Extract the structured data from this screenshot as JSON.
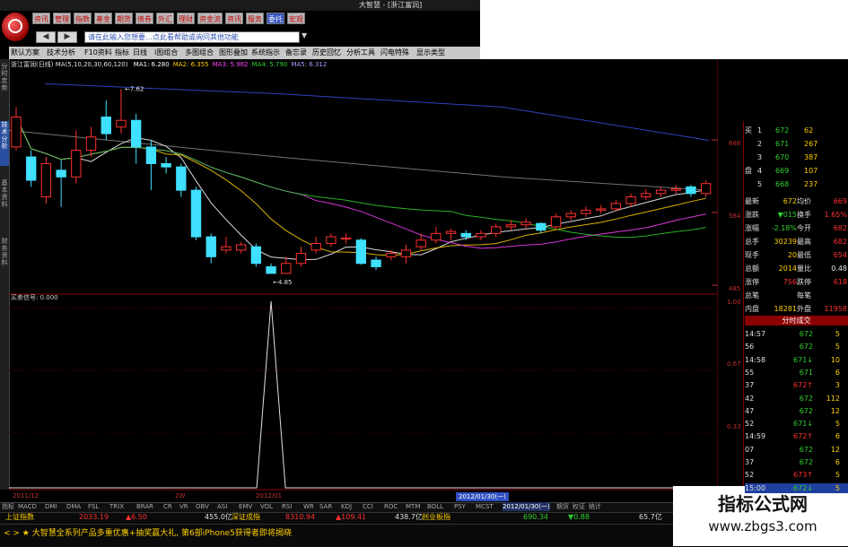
{
  "window": {
    "title": "大智慧 - [浙江富润]"
  },
  "top_buttons": [
    "资讯",
    "管理",
    "指数",
    "基金",
    "期货",
    "债券",
    "外汇",
    "理财",
    "资金流",
    "资讯",
    "服务",
    "委托",
    "宏观"
  ],
  "search": {
    "placeholder": "请在此输入您想要…点此看帮助或询问其他功能"
  },
  "toolbar": [
    "默认方案",
    "技术分析",
    "F10资料",
    "指标",
    "日线",
    "i图组合",
    "多图组合",
    "图形叠加",
    "系统指示",
    "备忘录",
    "历史回忆",
    "分析工具",
    "闪电特殊",
    "显示类型"
  ],
  "left_tabs": [
    "分时走势",
    "技术分析",
    "基本资料",
    "财务资料"
  ],
  "stock_name": "浙江富润(日线)",
  "ma_label": "MA(5,10,20,30,60,120)",
  "ma_values": [
    {
      "label": "MA1:",
      "value": "6.280",
      "color": "#ffffff"
    },
    {
      "label": "MA2:",
      "value": "6.355",
      "color": "#ffd000"
    },
    {
      "label": "MA3:",
      "value": "5.962",
      "color": "#ff40ff"
    },
    {
      "label": "MA4:",
      "value": "5.790",
      "color": "#30d030"
    },
    {
      "label": "MA5:",
      "value": "6.312",
      "color": "#a0a0ff"
    }
  ],
  "price_labels": {
    "high": "7.62",
    "low": "4.85"
  },
  "indicator_label": "买卖信号: 0.000",
  "y_axis": [
    "688",
    "584",
    "485",
    "1.00",
    "0.67",
    "0.33"
  ],
  "chart_data": {
    "type": "candlestick",
    "candles": [
      {
        "o": 6.75,
        "c": 7.2,
        "h": 7.35,
        "l": 6.7
      },
      {
        "o": 6.6,
        "c": 6.25,
        "h": 6.7,
        "l": 6.15
      },
      {
        "o": 6.0,
        "c": 6.5,
        "h": 6.6,
        "l": 5.9
      },
      {
        "o": 6.4,
        "c": 6.3,
        "h": 6.55,
        "l": 5.85
      },
      {
        "o": 6.3,
        "c": 6.7,
        "h": 7.0,
        "l": 6.2
      },
      {
        "o": 6.7,
        "c": 6.9,
        "h": 7.05,
        "l": 6.6
      },
      {
        "o": 7.2,
        "c": 6.95,
        "h": 7.45,
        "l": 6.85
      },
      {
        "o": 7.05,
        "c": 7.15,
        "h": 7.62,
        "l": 6.95
      },
      {
        "o": 7.15,
        "c": 6.75,
        "h": 7.25,
        "l": 6.5
      },
      {
        "o": 6.75,
        "c": 6.5,
        "h": 6.85,
        "l": 6.1
      },
      {
        "o": 6.5,
        "c": 6.45,
        "h": 6.6,
        "l": 6.35
      },
      {
        "o": 6.45,
        "c": 6.1,
        "h": 6.5,
        "l": 6.0
      },
      {
        "o": 6.1,
        "c": 5.4,
        "h": 6.15,
        "l": 5.35
      },
      {
        "o": 5.4,
        "c": 5.1,
        "h": 5.45,
        "l": 5.0
      },
      {
        "o": 5.2,
        "c": 5.25,
        "h": 5.4,
        "l": 5.15
      },
      {
        "o": 5.2,
        "c": 5.28,
        "h": 5.32,
        "l": 5.15
      },
      {
        "o": 5.25,
        "c": 5.0,
        "h": 5.3,
        "l": 4.95
      },
      {
        "o": 4.95,
        "c": 4.85,
        "h": 5.0,
        "l": 4.85
      },
      {
        "o": 4.85,
        "c": 5.0,
        "h": 5.1,
        "l": 4.85
      },
      {
        "o": 5.0,
        "c": 5.15,
        "h": 5.25,
        "l": 4.95
      },
      {
        "o": 5.2,
        "c": 5.3,
        "h": 5.4,
        "l": 5.15
      },
      {
        "o": 5.3,
        "c": 5.4,
        "h": 5.45,
        "l": 5.25
      },
      {
        "o": 5.38,
        "c": 5.38,
        "h": 5.45,
        "l": 5.3
      },
      {
        "o": 5.35,
        "c": 5.0,
        "h": 5.38,
        "l": 4.98
      },
      {
        "o": 5.05,
        "c": 4.95,
        "h": 5.1,
        "l": 4.9
      },
      {
        "o": 5.1,
        "c": 5.15,
        "h": 5.2,
        "l": 5.05
      },
      {
        "o": 5.1,
        "c": 5.2,
        "h": 5.28,
        "l": 5.0
      },
      {
        "o": 5.25,
        "c": 5.35,
        "h": 5.45,
        "l": 5.2
      },
      {
        "o": 5.35,
        "c": 5.45,
        "h": 5.55,
        "l": 5.3
      },
      {
        "o": 5.45,
        "c": 5.48,
        "h": 5.52,
        "l": 5.35
      },
      {
        "o": 5.45,
        "c": 5.4,
        "h": 5.5,
        "l": 5.35
      },
      {
        "o": 5.4,
        "c": 5.45,
        "h": 5.5,
        "l": 5.35
      },
      {
        "o": 5.45,
        "c": 5.55,
        "h": 5.6,
        "l": 5.4
      },
      {
        "o": 5.55,
        "c": 5.58,
        "h": 5.65,
        "l": 5.5
      },
      {
        "o": 5.58,
        "c": 5.62,
        "h": 5.68,
        "l": 5.52
      },
      {
        "o": 5.6,
        "c": 5.5,
        "h": 5.62,
        "l": 5.45
      },
      {
        "o": 5.55,
        "c": 5.7,
        "h": 5.75,
        "l": 5.5
      },
      {
        "o": 5.7,
        "c": 5.75,
        "h": 5.8,
        "l": 5.65
      },
      {
        "o": 5.75,
        "c": 5.8,
        "h": 5.85,
        "l": 5.7
      },
      {
        "o": 5.8,
        "c": 5.82,
        "h": 5.88,
        "l": 5.75
      },
      {
        "o": 5.82,
        "c": 5.9,
        "h": 5.95,
        "l": 5.78
      },
      {
        "o": 5.9,
        "c": 6.0,
        "h": 6.05,
        "l": 5.85
      },
      {
        "o": 6.0,
        "c": 6.05,
        "h": 6.12,
        "l": 5.95
      },
      {
        "o": 6.05,
        "c": 6.1,
        "h": 6.15,
        "l": 6.0
      },
      {
        "o": 6.1,
        "c": 6.12,
        "h": 6.18,
        "l": 6.05
      },
      {
        "o": 6.15,
        "c": 6.05,
        "h": 6.18,
        "l": 6.0
      },
      {
        "o": 6.05,
        "c": 6.2,
        "h": 6.25,
        "l": 6.0
      }
    ],
    "price_range": [
      4.7,
      7.8
    ],
    "signal": {
      "index": 17,
      "value": 1.0
    },
    "signal_range": [
      0,
      1
    ]
  },
  "quote": {
    "buy": [
      {
        "label": "买",
        "n": "1",
        "price": "672",
        "vol": "62"
      },
      {
        "label": "",
        "n": "2",
        "price": "671",
        "vol": "267"
      },
      {
        "label": "",
        "n": "3",
        "price": "670",
        "vol": "387"
      },
      {
        "label": "盘",
        "n": "4",
        "price": "669",
        "vol": "107"
      },
      {
        "label": "",
        "n": "5",
        "price": "668",
        "vol": "237"
      }
    ],
    "stats": [
      {
        "k1": "最新",
        "v1": "672",
        "k2": "均价",
        "v2": "669"
      },
      {
        "k1": "涨跌",
        "v1": "▼015",
        "k2": "换手",
        "v2": "1.65%"
      },
      {
        "k1": "涨幅",
        "v1": "-2.18%",
        "k2": "今开",
        "v2": "682"
      },
      {
        "k1": "总手",
        "v1": "30239",
        "k2": "最高",
        "v2": "682"
      },
      {
        "k1": "现手",
        "v1": "20",
        "k2": "最低",
        "v2": "654"
      },
      {
        "k1": "总额",
        "v1": "2014",
        "k2": "量比",
        "v2": "0.48"
      },
      {
        "k1": "涨停",
        "v1": "756",
        "k2": "跌停",
        "v2": "618"
      },
      {
        "k1": "总笔",
        "v1": "",
        "k2": "每笔",
        "v2": ""
      },
      {
        "k1": "内盘",
        "v1": "18281",
        "k2": "外盘",
        "v2": "11958"
      }
    ],
    "ticks_header": "分时成交",
    "ticks": [
      {
        "t": "14:57",
        "p": "672",
        "v": "5"
      },
      {
        "t": "56",
        "p": "672",
        "v": "5"
      },
      {
        "t": "14:58",
        "p": "671↓",
        "v": "10"
      },
      {
        "t": "55",
        "p": "671",
        "v": "6"
      },
      {
        "t": "37",
        "p": "672↑",
        "v": "3"
      },
      {
        "t": "42",
        "p": "672",
        "v": "112"
      },
      {
        "t": "47",
        "p": "672",
        "v": "12"
      },
      {
        "t": "52",
        "p": "671↓",
        "v": "5"
      },
      {
        "t": "14:59",
        "p": "672↑",
        "v": "6"
      },
      {
        "t": "07",
        "p": "672",
        "v": "12"
      },
      {
        "t": "37",
        "p": "672",
        "v": "6"
      },
      {
        "t": "52",
        "p": "673↑",
        "v": "5"
      },
      {
        "t": "15:00",
        "p": "672↓",
        "v": "5"
      }
    ]
  },
  "bottom_tabs": [
    "指标",
    "MACD",
    "DMI",
    "DMA",
    "FSL",
    "TRIX",
    "BRAR",
    "CR",
    "VR",
    "OBV",
    "ASI",
    "EMV",
    "VOL",
    "RSI",
    "WR",
    "SAR",
    "KDJ",
    "CCI",
    "ROC",
    "MTM",
    "BOLL",
    "PSY",
    "MCST",
    "2012/01/30(一)",
    "期货",
    "权证",
    "统计"
  ],
  "date_labels": {
    "d1": "2011/12",
    "d2": "2W",
    "d3": "2012/01",
    "cursor": "2012/01/30(一)"
  },
  "index_bar": [
    {
      "text": "上证指数",
      "cls": "yellow"
    },
    {
      "text": "2033.19",
      "cls": "red"
    },
    {
      "text": "▲6.50",
      "cls": "red"
    },
    {
      "text": "455.0亿",
      "cls": "white"
    },
    {
      "text": "深证成指",
      "cls": "yellow"
    },
    {
      "text": "8310.94",
      "cls": "red"
    },
    {
      "text": "▲109.41",
      "cls": "red"
    },
    {
      "text": "438.7亿",
      "cls": "white"
    },
    {
      "text": "创业板指",
      "cls": "yellow"
    },
    {
      "text": "690.34",
      "cls": "green"
    },
    {
      "text": "▼0.88",
      "cls": "green"
    },
    {
      "text": "65.7亿",
      "cls": "white"
    }
  ],
  "news": "< > ★ 大智慧全系列产品多重优惠+抽奖赢大礼, 第6部iPhone5获得者即将揭晓",
  "watermark": {
    "line1": "指标公式网",
    "line2": "www.zbgs3.com"
  }
}
